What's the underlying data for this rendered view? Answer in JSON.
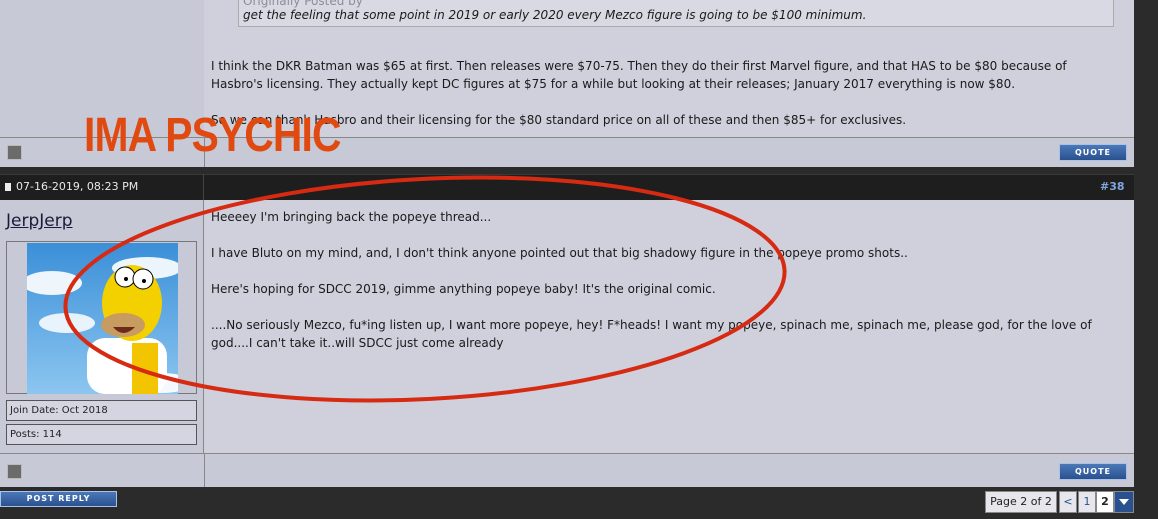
{
  "post_prev": {
    "quote_line1": "Originally Posted by",
    "quote_text": "get the feeling that some point in 2019 or early 2020 every Mezco figure is going to be $100 minimum.",
    "para1": "I think the DKR Batman was $65 at first. Then releases were $70-75. Then they do their first Marvel figure, and that HAS to be $80 because of Hasbro's licensing. They actually kept DC figures at $75 for a while but looking at their releases; January 2017 everything is now $80.",
    "para2": "So we can thank Hasbro and their licensing for the $80 standard price on all of these and then $85+ for exclusives.",
    "quote_label": "QUOTE"
  },
  "overlay": {
    "psychic_text": "IMA PSYCHIC",
    "color": "#e04a10"
  },
  "post": {
    "date": "07-16-2019, 08:23 PM",
    "number": "#38",
    "username": "JerpJerp",
    "join_date": "Join Date: Oct 2018",
    "posts": "Posts: 114",
    "lines": [
      "Heeeey I'm bringing back the popeye thread...",
      "I have Bluto on my mind, and, I don't think anyone pointed out that big shadowy figure in the popeye promo shots..",
      "Here's hoping for SDCC 2019, gimme anything popeye baby! It's the original comic.",
      "....No seriously Mezco, fu*ing listen up, I want more popeye, hey! F*heads! I want my popeye, spinach me, spinach me, please god, for the love of god....I can't take it..will SDCC just come already"
    ],
    "quote_label": "QUOTE"
  },
  "footer": {
    "post_reply": "POST REPLY",
    "page_label": "Page 2 of 2",
    "prev": "<",
    "page1": "1",
    "page2": "2",
    "menu_icon": "chevron-down-icon"
  }
}
